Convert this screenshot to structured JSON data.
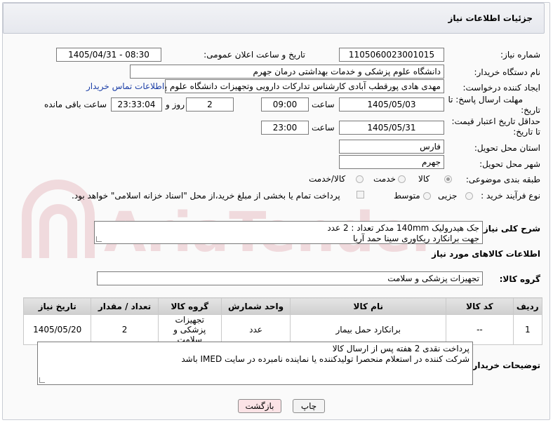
{
  "header": {
    "title": "جزئیات اطلاعات نیاز"
  },
  "fields": {
    "need_number": {
      "label": "شماره نیاز:",
      "value": "1105060023001015"
    },
    "announce": {
      "label": "تاریخ و ساعت اعلان عمومی:",
      "value": "1405/04/31 - 08:30"
    },
    "buyer_org": {
      "label": "نام دستگاه خریدار:",
      "value": "دانشگاه علوم پزشکی و خدمات بهداشتی  درمان جهرم"
    },
    "requester": {
      "label": "ایجاد کننده درخواست:",
      "value": "مهدی هادی پورقطب آبادی کارشناس تدارکات دارویی وتجهیزات دانشگاه علوم پز",
      "contact_link": "اطلاعات تماس خریدار"
    },
    "deadline": {
      "label_line1": "مهلت ارسال پاسخ: تا",
      "label_line2": "تاریخ:",
      "date": "1405/05/03",
      "time_label": "ساعت",
      "time": "09:00",
      "days": "2",
      "days_label": "روز و",
      "remaining": "23:33:04",
      "remaining_label": "ساعت باقی مانده"
    },
    "price_validity": {
      "label_line1": "حداقل تاریخ اعتبار قیمت:",
      "label_line2": "تا تاریخ:",
      "date": "1405/05/31",
      "time_label": "ساعت",
      "time": "23:00"
    },
    "province": {
      "label": "استان محل تحویل:",
      "value": "فارس"
    },
    "city": {
      "label": "شهر محل تحویل:",
      "value": "جهرم"
    },
    "category": {
      "label": "طبقه بندی موضوعی:",
      "options": [
        "کالا",
        "خدمت",
        "کالا/خدمت"
      ],
      "selected": "کالا"
    },
    "process": {
      "label": "نوع فرآیند خرید :",
      "options": [
        "جزیی",
        "متوسط"
      ],
      "payment_note": "پرداخت تمام یا بخشی از مبلغ خرید،از محل \"اسناد خزانه اسلامی\" خواهد بود."
    }
  },
  "summary": {
    "label": "شرح کلی نیاز:",
    "line1": "جک هیدرولیک 140mm  مدکر       تعداد : 2 عدد",
    "line2": "جهت برانکارد ریکاوری سینا حمد آریا"
  },
  "goods_section": {
    "title": "اطلاعات کالاهای مورد نیاز"
  },
  "goods_group": {
    "label": "گروه کالا:",
    "value": "تجهیزات پزشکی و سلامت"
  },
  "table": {
    "headers": [
      "ردیف",
      "کد کالا",
      "نام کالا",
      "واحد شمارش",
      "گروه کالا",
      "تعداد / مقدار",
      "تاریخ نیاز"
    ],
    "rows": [
      [
        "1",
        "--",
        "برانکارد حمل بیمار",
        "عدد",
        "تجهیزات پزشکی و سلامت",
        "2",
        "1405/05/20"
      ]
    ]
  },
  "buyer_notes": {
    "label": "توضیحات خریدار:",
    "line1": "پرداخت نقدی 2 هفته پس از ارسال کالا",
    "line2": "شرکت کننده در استعلام منحصرا تولیدکننده یا نماینده نامبرده در سایت IMED باشد"
  },
  "buttons": {
    "print": "چاپ",
    "back": "بازگشت"
  },
  "watermark": {
    "text": "AriaTender.net"
  },
  "colors": {
    "link": "#1a3da6",
    "back_button_bg": "#fbe3e6",
    "watermark": "#b01020"
  }
}
